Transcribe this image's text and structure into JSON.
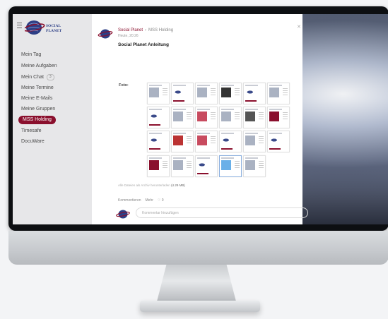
{
  "sidebar": {
    "brand": "SOCIAL PLANET",
    "items": [
      {
        "label": "Mein Tag"
      },
      {
        "label": "Meine Aufgaben"
      },
      {
        "label": "Mein Chat",
        "badge": "3"
      },
      {
        "label": "Meine Termine"
      },
      {
        "label": "Meine E-Mails"
      },
      {
        "label": "Meine Gruppen"
      },
      {
        "label": "MSS Holding",
        "active": true
      },
      {
        "label": "Timesafe"
      },
      {
        "label": "DocuWare"
      }
    ]
  },
  "post": {
    "author": "Social Planet",
    "separator": "›",
    "group": "MSS Holding",
    "time": "Heute, 20:26",
    "title": "Social Planet Anleitung",
    "fotos_label": "Foto:",
    "archive_note": "Alle Dateien als Archiv herunterladen",
    "archive_size": "(4.29 MB)"
  },
  "comments": {
    "kommentieren": "Kommentieren",
    "mehr": "Mehr",
    "likes": "♡ 0",
    "placeholder": "Kommentar hinzufügen"
  },
  "colors": {
    "accent": "#8a0f2d",
    "sidebar_bg": "#e7e7e9",
    "bezel": "#0d0f12"
  }
}
